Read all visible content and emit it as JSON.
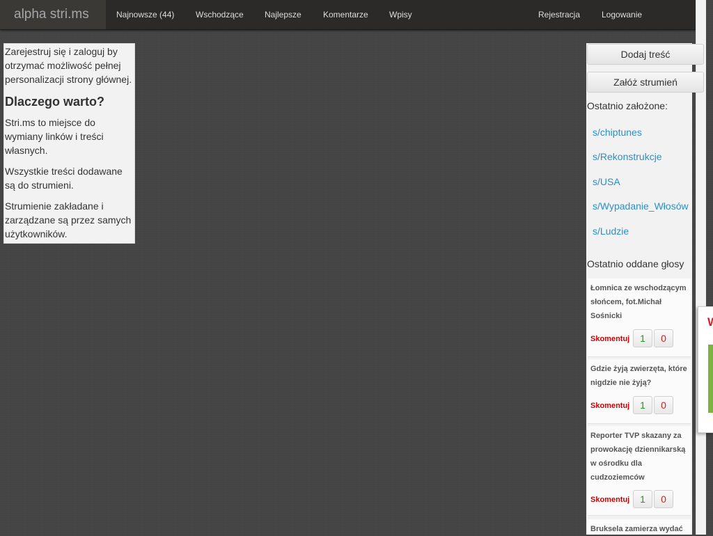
{
  "brand": "alpha stri.ms",
  "nav": {
    "items": [
      "Najnowsze (44)",
      "Wschodzące",
      "Najlepsze",
      "Komentarze",
      "Wpisy"
    ],
    "register": "Rejestracja",
    "login": "Logowanie"
  },
  "left": {
    "intro": "Zarejestruj się i zaloguj by otrzymać możliwość pełnej personalizacji strony głównej.",
    "heading": "Dlaczego warto?",
    "p1": "Stri.ms to miejsce do wymiany linków i treści własnych.",
    "p2": "Wszystkie treści dodawane są do strumieni.",
    "p3": "Strumienie zakładane i zarządzane są przez samych użytkowników."
  },
  "sidebar": {
    "add_content": "Dodaj treść",
    "create_stream": "Załóż strumień",
    "recent_streams_label": "Ostatnio założone:",
    "recent_streams": [
      "s/chiptunes",
      "s/Rekonstrukcje",
      "s/USA",
      "s/Wypadanie_Włosów",
      "s/Ludzie"
    ],
    "recent_votes_label": "Ostatnio oddane głosy",
    "votes": [
      {
        "title": "Łomnica ze wschodzącym słońcem, fot.Michał Sośnicki",
        "comment": "Skomentuj",
        "up": "1",
        "down": "0"
      },
      {
        "title": "Gdzie żyją zwierzęta, które nigdzie nie żyją?",
        "comment": "Skomentuj",
        "up": "1",
        "down": "0"
      },
      {
        "title": "Reporter TVP skazany za prowokację dziennikarską w ośrodku dla cudzoziemców",
        "comment": "Skomentuj",
        "up": "1",
        "down": "0"
      },
      {
        "title": "Bruksela zamierza wydać"
      }
    ]
  },
  "popup": {
    "title": "W"
  }
}
